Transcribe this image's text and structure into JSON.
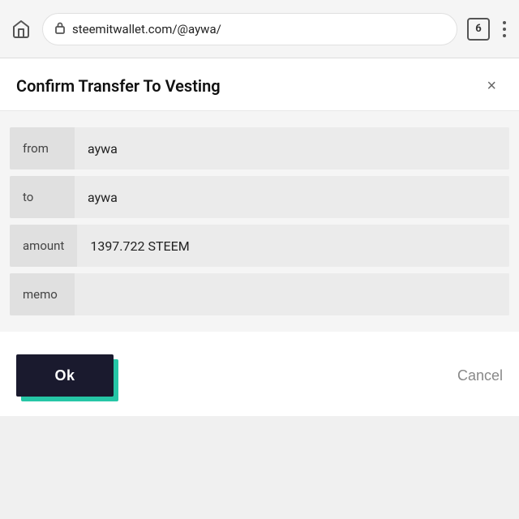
{
  "browser": {
    "url": "steemitwallet.com/@aywa/",
    "tab_count": "6",
    "home_label": "home"
  },
  "modal": {
    "title": "Confirm Transfer To Vesting",
    "close_label": "×",
    "fields": [
      {
        "label": "from",
        "value": "aywa"
      },
      {
        "label": "to",
        "value": "aywa"
      },
      {
        "label": "amount",
        "value": "1397.722 STEEM"
      },
      {
        "label": "memo",
        "value": ""
      }
    ],
    "ok_button": "Ok",
    "cancel_button": "Cancel"
  }
}
